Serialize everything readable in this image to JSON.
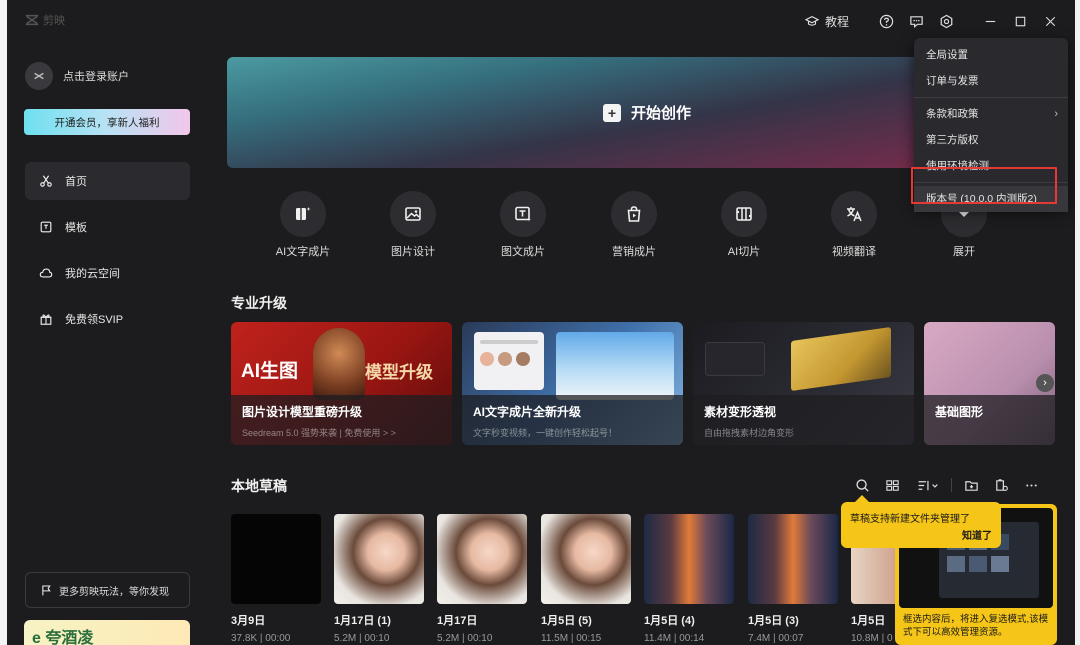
{
  "window": {
    "app_name": "剪映",
    "tutorial_label": "教程"
  },
  "sidebar": {
    "login_label": "点击登录账户",
    "vip_button": "开通会员，享新人福利",
    "nav": [
      {
        "label": "首页",
        "icon": "scissors-icon"
      },
      {
        "label": "模板",
        "icon": "template-icon"
      },
      {
        "label": "我的云空间",
        "icon": "cloud-icon"
      },
      {
        "label": "免费领SVIP",
        "icon": "gift-icon"
      }
    ],
    "discover_label": "更多剪映玩法，等你发现",
    "promo_text": "e 夸酒凌"
  },
  "hero": {
    "label": "开始创作"
  },
  "tools": [
    {
      "label": "AI文字成片",
      "icon": "ai-text-video-icon"
    },
    {
      "label": "图片设计",
      "icon": "image-design-icon"
    },
    {
      "label": "图文成片",
      "icon": "text-image-icon"
    },
    {
      "label": "营销成片",
      "icon": "marketing-bag-icon"
    },
    {
      "label": "AI切片",
      "icon": "ai-slice-icon"
    },
    {
      "label": "视频翻译",
      "icon": "translate-icon"
    },
    {
      "label": "展开",
      "icon": "expand-icon"
    }
  ],
  "upgrade": {
    "title": "专业升级",
    "cards": [
      {
        "title": "图片设计模型重磅升级",
        "subtitle": "Seedream 5.0 强势来袭 | 免费使用 > >",
        "art_text_left": "AI生图",
        "art_text_right": "模型升级"
      },
      {
        "title": "AI文字成片全新升级",
        "subtitle": "文字秒变视频，一键创作轻松起号！"
      },
      {
        "title": "素材变形透视",
        "subtitle": "自由拖拽素材边角变形"
      },
      {
        "title": "基础图形",
        "subtitle": ""
      }
    ]
  },
  "drafts": {
    "title": "本地草稿",
    "items": [
      {
        "name": "3月9日",
        "meta": "37.8K | 00:00"
      },
      {
        "name": "1月17日 (1)",
        "meta": "5.2M | 00:10"
      },
      {
        "name": "1月17日",
        "meta": "5.2M | 00:10"
      },
      {
        "name": "1月5日 (5)",
        "meta": "11.5M | 00:15"
      },
      {
        "name": "1月5日 (4)",
        "meta": "11.4M | 00:14"
      },
      {
        "name": "1月5日 (3)",
        "meta": "7.4M | 00:07"
      },
      {
        "name": "1月5日",
        "meta": "10.8M | 0"
      }
    ]
  },
  "tooltip": {
    "text": "草稿支持新建文件夹管理了",
    "ok": "知道了"
  },
  "guide": {
    "text": "框选内容后，将进入复选模式,该模式下可以高效管理资源。"
  },
  "menu": {
    "items": [
      {
        "label": "全局设置"
      },
      {
        "label": "订单与发票"
      },
      {
        "label": "条款和政策",
        "chevron": "›"
      },
      {
        "label": "第三方版权"
      },
      {
        "label": "使用环境检测"
      },
      {
        "label": "版本号 (10.0.0 内测版2)"
      }
    ]
  },
  "colors": {
    "background": "#1c1c1e",
    "accent_yellow": "#f5c518",
    "highlight_red": "#e53935"
  }
}
